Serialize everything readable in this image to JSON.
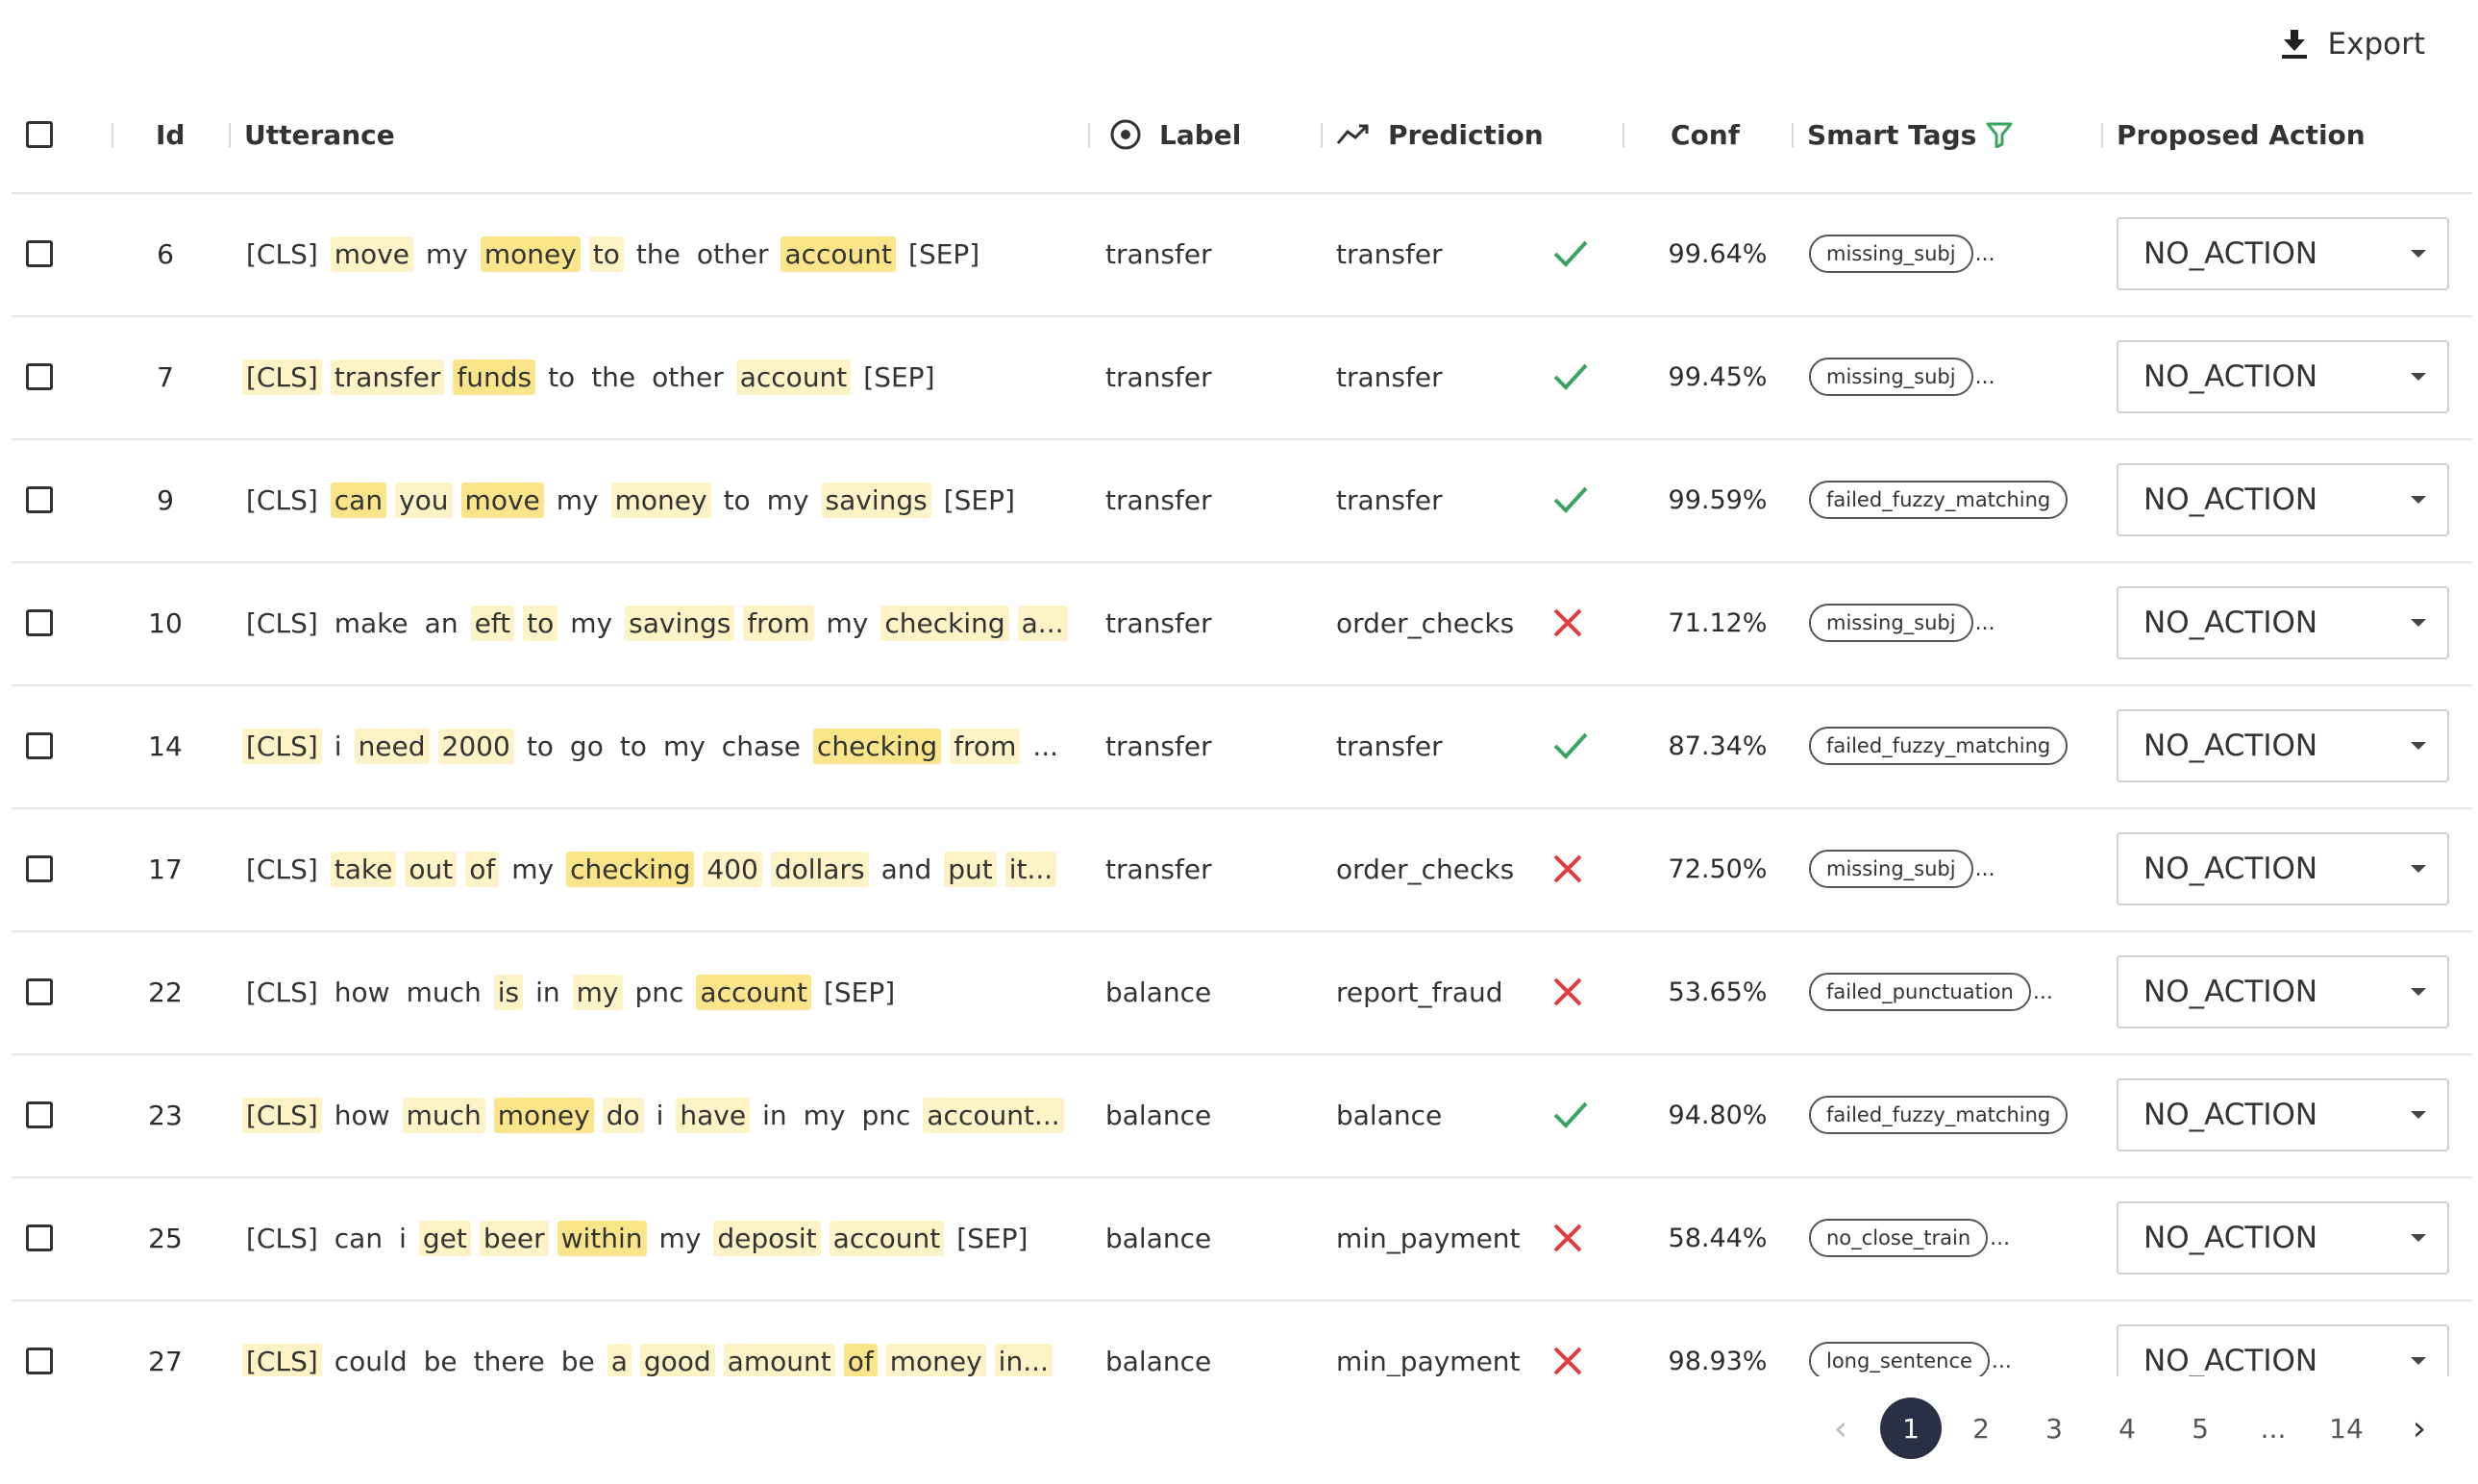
{
  "export_label": "Export",
  "columns": {
    "id": "Id",
    "utterance": "Utterance",
    "label": "Label",
    "prediction": "Prediction",
    "conf": "Conf",
    "smart_tags": "Smart Tags",
    "proposed_action": "Proposed Action"
  },
  "colors": {
    "correct": "#3aa55e",
    "wrong": "#e03a3a",
    "highlight_light": "#fdf3c7",
    "highlight_strong": "#fbe58a",
    "filter_icon": "#3aa55e",
    "active_page": "#2a2f45"
  },
  "rows": [
    {
      "id": "6",
      "utterance": [
        [
          "[CLS]",
          0
        ],
        [
          "move",
          1
        ],
        [
          "my",
          0
        ],
        [
          "money",
          2
        ],
        [
          "to",
          1
        ],
        [
          "the",
          0
        ],
        [
          "other",
          0
        ],
        [
          "account",
          2
        ],
        [
          "[SEP]",
          0
        ]
      ],
      "label": "transfer",
      "prediction": "transfer",
      "correct": true,
      "conf": "99.64%",
      "tag": "missing_subj",
      "more": "...",
      "action": "NO_ACTION"
    },
    {
      "id": "7",
      "utterance": [
        [
          "[CLS]",
          1
        ],
        [
          "transfer",
          1
        ],
        [
          "funds",
          2
        ],
        [
          "to",
          0
        ],
        [
          "the",
          0
        ],
        [
          "other",
          0
        ],
        [
          "account",
          1
        ],
        [
          "[SEP]",
          0
        ]
      ],
      "label": "transfer",
      "prediction": "transfer",
      "correct": true,
      "conf": "99.45%",
      "tag": "missing_subj",
      "more": "...",
      "action": "NO_ACTION"
    },
    {
      "id": "9",
      "utterance": [
        [
          "[CLS]",
          0
        ],
        [
          "can",
          2
        ],
        [
          "you",
          1
        ],
        [
          "move",
          2
        ],
        [
          "my",
          0
        ],
        [
          "money",
          1
        ],
        [
          "to",
          0
        ],
        [
          "my",
          0
        ],
        [
          "savings",
          1
        ],
        [
          "[SEP]",
          0
        ]
      ],
      "label": "transfer",
      "prediction": "transfer",
      "correct": true,
      "conf": "99.59%",
      "tag": "failed_fuzzy_matching",
      "more": "",
      "action": "NO_ACTION"
    },
    {
      "id": "10",
      "utterance": [
        [
          "[CLS]",
          0
        ],
        [
          "make",
          0
        ],
        [
          "an",
          0
        ],
        [
          "eft",
          1
        ],
        [
          "to",
          1
        ],
        [
          "my",
          0
        ],
        [
          "savings",
          1
        ],
        [
          "from",
          1
        ],
        [
          "my",
          0
        ],
        [
          "checking",
          1
        ],
        [
          "a...",
          1
        ]
      ],
      "label": "transfer",
      "prediction": "order_checks",
      "correct": false,
      "conf": "71.12%",
      "tag": "missing_subj",
      "more": "...",
      "action": "NO_ACTION"
    },
    {
      "id": "14",
      "utterance": [
        [
          "[CLS]",
          1
        ],
        [
          "i",
          0
        ],
        [
          "need",
          1
        ],
        [
          "2000",
          1
        ],
        [
          "to",
          0
        ],
        [
          "go",
          0
        ],
        [
          "to",
          0
        ],
        [
          "my",
          0
        ],
        [
          "chase",
          0
        ],
        [
          "checking",
          2
        ],
        [
          "from",
          1
        ],
        [
          "...",
          0
        ]
      ],
      "label": "transfer",
      "prediction": "transfer",
      "correct": true,
      "conf": "87.34%",
      "tag": "failed_fuzzy_matching",
      "more": "",
      "action": "NO_ACTION"
    },
    {
      "id": "17",
      "utterance": [
        [
          "[CLS]",
          0
        ],
        [
          "take",
          1
        ],
        [
          "out",
          1
        ],
        [
          "of",
          1
        ],
        [
          "my",
          0
        ],
        [
          "checking",
          2
        ],
        [
          "400",
          1
        ],
        [
          "dollars",
          1
        ],
        [
          "and",
          0
        ],
        [
          "put",
          1
        ],
        [
          "it...",
          1
        ]
      ],
      "label": "transfer",
      "prediction": "order_checks",
      "correct": false,
      "conf": "72.50%",
      "tag": "missing_subj",
      "more": "...",
      "action": "NO_ACTION"
    },
    {
      "id": "22",
      "utterance": [
        [
          "[CLS]",
          0
        ],
        [
          "how",
          0
        ],
        [
          "much",
          0
        ],
        [
          "is",
          1
        ],
        [
          "in",
          0
        ],
        [
          "my",
          1
        ],
        [
          "pnc",
          0
        ],
        [
          "account",
          2
        ],
        [
          "[SEP]",
          0
        ]
      ],
      "label": "balance",
      "prediction": "report_fraud",
      "correct": false,
      "conf": "53.65%",
      "tag": "failed_punctuation",
      "more": "...",
      "action": "NO_ACTION"
    },
    {
      "id": "23",
      "utterance": [
        [
          "[CLS]",
          1
        ],
        [
          "how",
          0
        ],
        [
          "much",
          1
        ],
        [
          "money",
          2
        ],
        [
          "do",
          1
        ],
        [
          "i",
          0
        ],
        [
          "have",
          1
        ],
        [
          "in",
          0
        ],
        [
          "my",
          0
        ],
        [
          "pnc",
          0
        ],
        [
          "account...",
          1
        ]
      ],
      "label": "balance",
      "prediction": "balance",
      "correct": true,
      "conf": "94.80%",
      "tag": "failed_fuzzy_matching",
      "more": "",
      "action": "NO_ACTION"
    },
    {
      "id": "25",
      "utterance": [
        [
          "[CLS]",
          0
        ],
        [
          "can",
          0
        ],
        [
          "i",
          0
        ],
        [
          "get",
          1
        ],
        [
          "beer",
          1
        ],
        [
          "within",
          2
        ],
        [
          "my",
          0
        ],
        [
          "deposit",
          1
        ],
        [
          "account",
          1
        ],
        [
          "[SEP]",
          0
        ]
      ],
      "label": "balance",
      "prediction": "min_payment",
      "correct": false,
      "conf": "58.44%",
      "tag": "no_close_train",
      "more": "...",
      "action": "NO_ACTION"
    },
    {
      "id": "27",
      "utterance": [
        [
          "[CLS]",
          1
        ],
        [
          "could",
          0
        ],
        [
          "be",
          0
        ],
        [
          "there",
          0
        ],
        [
          "be",
          0
        ],
        [
          "a",
          1
        ],
        [
          "good",
          1
        ],
        [
          "amount",
          1
        ],
        [
          "of",
          2
        ],
        [
          "money",
          1
        ],
        [
          "in...",
          1
        ]
      ],
      "label": "balance",
      "prediction": "min_payment",
      "correct": false,
      "conf": "98.93%",
      "tag": "long_sentence",
      "more": "...",
      "action": "NO_ACTION"
    }
  ],
  "pagination": {
    "pages": [
      "1",
      "2",
      "3",
      "4",
      "5",
      "...",
      "14"
    ],
    "current": "1",
    "prev": "‹",
    "next": "›"
  }
}
